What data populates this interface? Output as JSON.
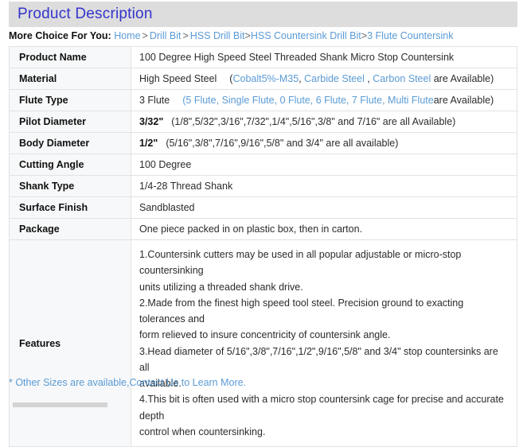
{
  "header": {
    "title": "Product Description"
  },
  "breadcrumb": {
    "label": "More Choice For You:",
    "items": [
      {
        "text": "Home",
        "sep": ">"
      },
      {
        "text": "Drill Bit",
        "sep": ">"
      },
      {
        "text": "HSS Drill Bit",
        "sep": ">"
      },
      {
        "text": "HSS Countersink Drill Bit",
        "sep": ">"
      },
      {
        "text": "3 Flute Countersink",
        "sep": ""
      }
    ]
  },
  "spec_table": {
    "rows": [
      {
        "label": "Product Name",
        "value": "100 Degree High Speed Steel Threaded Shank Micro Stop Countersink"
      },
      {
        "label": "Material",
        "value_main": "High Speed Steel",
        "options_open": "(",
        "options": [
          "Cobalt5%-M35",
          "Carbide Steel ",
          "Carbon Steel"
        ],
        "options_tail": " are Available)"
      },
      {
        "label": "Flute Type",
        "value_main": "3 Flute",
        "options_open": "(",
        "options": [
          "5 Flute",
          "Single Flute",
          "0 Flute",
          " 6 Flute",
          "7 Flute",
          " Multi Flute"
        ],
        "options_tail": "are Available)"
      },
      {
        "label": "Pilot Diameter",
        "value_strong": "3/32\"",
        "value_note": "(1/8\",5/32\",3/16\",7/32\",1/4\",5/16\",3/8\" and 7/16\" are all Available)"
      },
      {
        "label": "Body Diameter",
        "value_strong": "1/2\"",
        "value_note": "(5/16\",3/8\",7/16\",9/16\",5/8\" and 3/4\" are all available)"
      },
      {
        "label": "Cutting Angle",
        "value": "100 Degree"
      },
      {
        "label": "Shank Type",
        "value": "1/4-28 Thread Shank"
      },
      {
        "label": "Surface Finish",
        "value": "Sandblasted"
      },
      {
        "label": "Package",
        "value": "One piece packed in on plastic box, then in carton."
      }
    ],
    "features": {
      "label": "Features",
      "lines": [
        "1.Countersink cutters may be used in all popular adjustable or micro-stop countersinking",
        "units utilizing a threaded shank drive.",
        "2.Made from the finest high speed tool steel. Precision ground to exacting tolerances and",
        "form relieved to insure concentricity of countersink angle.",
        "3.Head diameter of 5/16\",3/8\",7/16\",1/2\",9/16\",5/8\" and 3/4\" stop countersinks are all",
        "available.",
        "4.This bit is often used with a micro stop countersink cage for precise and accurate depth",
        "control when countersinking."
      ]
    }
  },
  "footer": {
    "note": "* Other Sizes are available,Contact Us to Learn More."
  },
  "colors": {
    "accent_blue": "#5b9bd5",
    "title_blue": "#3333cc",
    "header_band": "#dddddd",
    "label_bg": "#f7f8f9",
    "border": "#e2e2e2"
  }
}
